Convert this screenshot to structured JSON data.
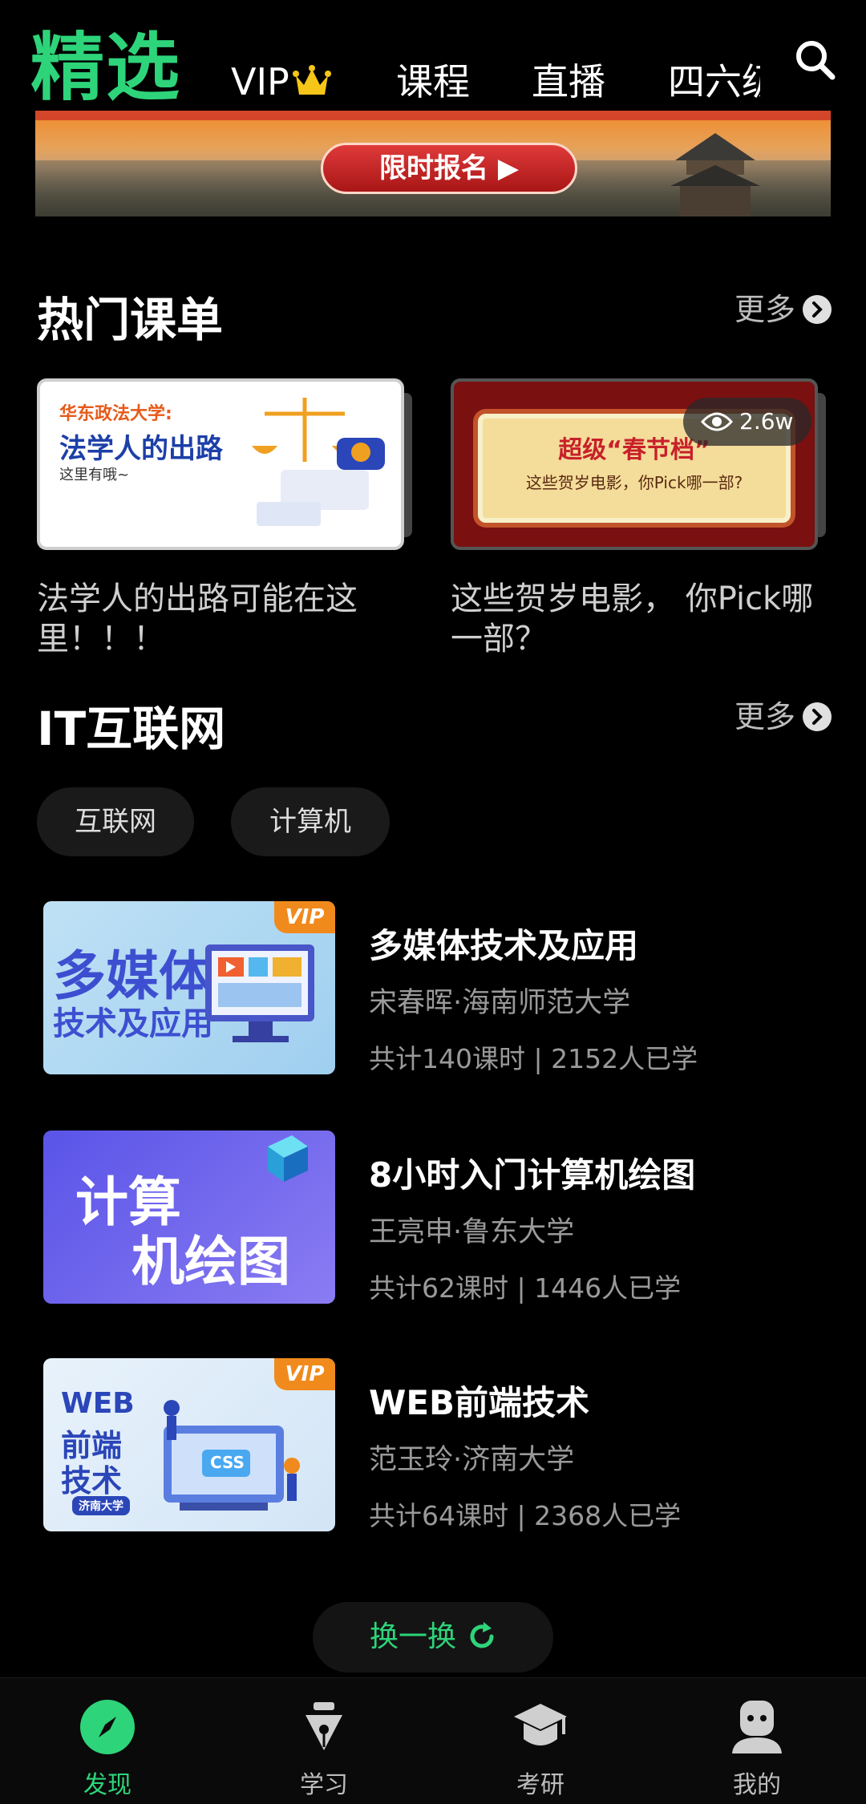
{
  "top_nav": {
    "active_tab": "精选",
    "tabs": [
      "VIP",
      "课程",
      "直播",
      "四六级"
    ]
  },
  "banner": {
    "cta_label": "限时报名 ▶"
  },
  "hot_lists": {
    "title": "热门课单",
    "more_label": "更多",
    "cards": [
      {
        "image_title_small": "华东政法大学:",
        "image_title_big": "法学人的出路",
        "image_sub": "这里有哦~",
        "caption": "法学人的出路可能在这里！！！"
      },
      {
        "image_title": "超级“春节档”",
        "image_sub": "这些贺岁电影，你Pick哪一部?",
        "views": "2.6w",
        "caption": "这些贺岁电影， 你Pick哪一部？"
      }
    ]
  },
  "it_section": {
    "title": "IT互联网",
    "more_label": "更多",
    "chips": [
      "互联网",
      "计算机"
    ],
    "courses": [
      {
        "thumb_text_1": "多媒体",
        "thumb_text_2": "技术及应用",
        "vip": "VIP",
        "title": "多媒体技术及应用",
        "teacher": "宋春晖·海南师范大学",
        "stats": "共计140课时 | 2152人已学"
      },
      {
        "thumb_text_1": "计算",
        "thumb_text_2": "机绘图",
        "title": "8小时入门计算机绘图",
        "teacher": "王亮申·鲁东大学",
        "stats": "共计62课时 | 1446人已学"
      },
      {
        "thumb_text_1": "WEB",
        "thumb_text_2": "前端",
        "thumb_text_3": "技术",
        "thumb_text_4": "济南大学",
        "thumb_css": "CSS",
        "vip": "VIP",
        "title": "WEB前端技术",
        "teacher": "范玉玲·济南大学",
        "stats": "共计64课时 | 2368人已学"
      }
    ],
    "refresh_label": "换一换"
  },
  "bottom_nav": {
    "items": [
      "发现",
      "学习",
      "考研",
      "我的"
    ],
    "active": "发现"
  },
  "colors": {
    "accent": "#2ed47a",
    "background": "#000000",
    "muted_text": "#9a9a9a",
    "vip_orange": "#f08a1c"
  }
}
